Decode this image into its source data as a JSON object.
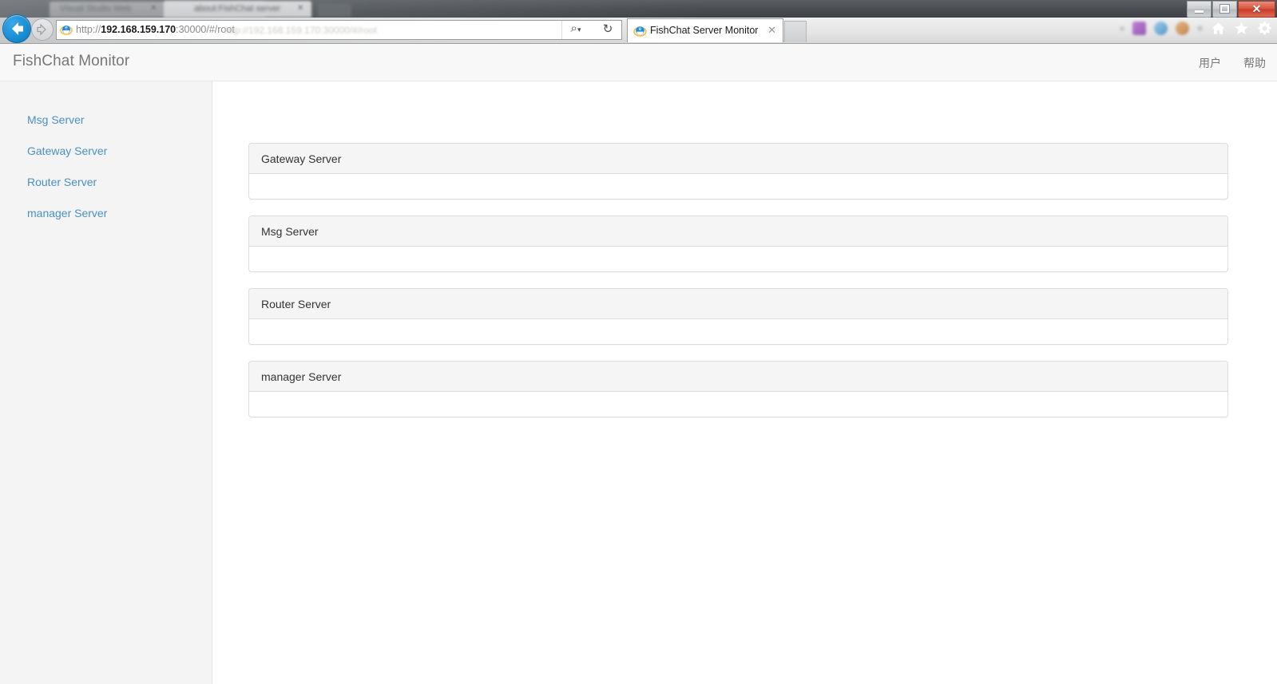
{
  "browser": {
    "window_controls": {
      "minimize": "minimize-button",
      "restore": "restore-button",
      "close_label": "✕"
    },
    "background_tabs": [
      {
        "title": "Visual Studio Web"
      },
      {
        "title": "about:FishChat server"
      }
    ],
    "address": {
      "scheme": "http://",
      "host": "192.168.159.170",
      "rest": ":30000/#/root",
      "full": "http://192.168.159.170:30000/#/root",
      "ghost_suggestion": "http://192.168.159.170:30000/#/root"
    },
    "active_tab": {
      "title": "FishChat Server Monitor",
      "close_label": "✕"
    },
    "toolbar": {
      "search_glyph": "⌕",
      "search_dropdown_glyph": "▾",
      "refresh_glyph": "↻",
      "home_glyph": "⌂",
      "favorites_glyph": "★",
      "tools_glyph": "⚙"
    }
  },
  "app": {
    "header": {
      "brand": "FishChat Monitor",
      "nav": [
        {
          "label": "用户",
          "name": "user"
        },
        {
          "label": "帮助",
          "name": "help"
        }
      ]
    },
    "sidebar": {
      "items": [
        {
          "label": "Msg Server"
        },
        {
          "label": "Gateway Server"
        },
        {
          "label": "Router Server"
        },
        {
          "label": "manager Server"
        }
      ]
    },
    "panels": [
      {
        "title": "Gateway Server",
        "body": ""
      },
      {
        "title": "Msg Server",
        "body": ""
      },
      {
        "title": "Router Server",
        "body": ""
      },
      {
        "title": "manager Server",
        "body": ""
      }
    ]
  },
  "colors": {
    "link": "#4a90c4",
    "sidebar_bg": "#f4f4f4",
    "panel_heading_bg": "#f5f5f5",
    "panel_border": "#dddddd",
    "header_bg": "#f8f8f8",
    "brand_text": "#777777"
  }
}
